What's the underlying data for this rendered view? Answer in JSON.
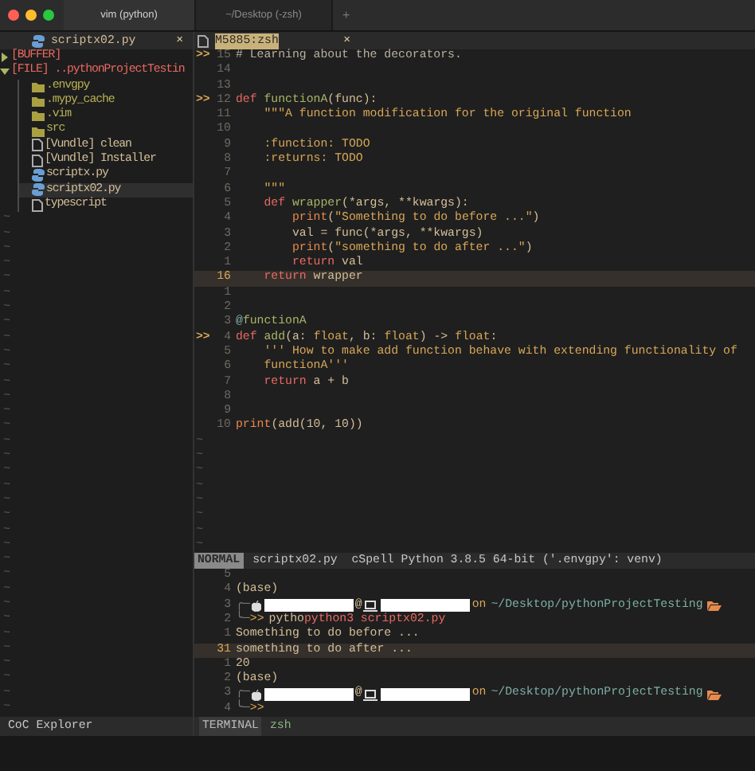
{
  "window": {
    "tabs": [
      {
        "label": "vim (python)",
        "selected": true
      },
      {
        "label": "~/Desktop (-zsh)",
        "selected": false
      }
    ],
    "new_tab": "+"
  },
  "sidebar": {
    "tab": {
      "label": "scriptx02.py",
      "close": "×"
    },
    "tree": [
      {
        "label": "[BUFFER]",
        "kind": "group",
        "expanded": false
      },
      {
        "label": "[FILE] ..pythonProjectTestin",
        "kind": "group",
        "expanded": true,
        "children": [
          {
            "label": ".envgpy",
            "kind": "folder",
            "selected": false
          },
          {
            "label": ".mypy_cache",
            "kind": "folder",
            "selected": false
          },
          {
            "label": ".vim",
            "kind": "folder",
            "selected": false
          },
          {
            "label": "src",
            "kind": "folder",
            "selected": false
          },
          {
            "label": "[Vundle] clean",
            "kind": "file",
            "selected": false
          },
          {
            "label": "[Vundle] Installer",
            "kind": "file",
            "selected": false
          },
          {
            "label": "scriptx.py",
            "kind": "python",
            "selected": false
          },
          {
            "label": "scriptx02.py",
            "kind": "python",
            "selected": true
          },
          {
            "label": "typescript",
            "kind": "file",
            "selected": false
          }
        ]
      }
    ],
    "empty_lines": [
      "~",
      "~",
      "~",
      "~",
      "~",
      "~",
      "~",
      "~",
      "~",
      "~",
      "~",
      "~",
      "~",
      "~",
      "~",
      "~",
      "~",
      "~",
      "~",
      "~",
      "~",
      "~",
      "~",
      "~",
      "~",
      "~",
      "~",
      "~",
      "~",
      "~",
      "~",
      "~",
      "~",
      "~"
    ],
    "title": "CoC Explorer"
  },
  "editor": {
    "tab": {
      "label": "M5885:zsh",
      "close": "×"
    },
    "lines": [
      {
        "num": "15",
        "sign": ">>",
        "current": false,
        "tokens": [
          {
            "text": "# Learning about the decorators.",
            "kind": "comment"
          }
        ]
      },
      {
        "num": "14",
        "current": false
      },
      {
        "num": "13",
        "current": false
      },
      {
        "num": "12",
        "sign": ">>",
        "current": false,
        "tokens": [
          {
            "text": "def ",
            "kind": "keyword"
          },
          {
            "text": "functionA",
            "kind": "function"
          },
          {
            "text": "(",
            "kind": "plain"
          },
          {
            "text": "func",
            "kind": "param"
          },
          {
            "text": "):",
            "kind": "plain"
          }
        ]
      },
      {
        "num": "11",
        "current": false,
        "tokens": [
          {
            "text": "    \"\"\"A function modification for the original function",
            "kind": "string"
          }
        ]
      },
      {
        "num": "10",
        "current": false
      },
      {
        "num": "9",
        "current": false,
        "tokens": [
          {
            "text": "    :function: TODO",
            "kind": "string"
          }
        ]
      },
      {
        "num": "8",
        "current": false,
        "tokens": [
          {
            "text": "    :returns: TODO",
            "kind": "string"
          }
        ]
      },
      {
        "num": "7",
        "current": false
      },
      {
        "num": "6",
        "current": false,
        "tokens": [
          {
            "text": "    \"\"\"",
            "kind": "string"
          }
        ]
      },
      {
        "num": "5",
        "current": false,
        "tokens": [
          {
            "text": "    def ",
            "kind": "keyword"
          },
          {
            "text": "wrapper",
            "kind": "function"
          },
          {
            "text": "(*args, **kwargs):",
            "kind": "plain"
          }
        ]
      },
      {
        "num": "4",
        "current": false,
        "tokens": [
          {
            "text": "        print",
            "kind": "builtin"
          },
          {
            "text": "(",
            "kind": "plain"
          },
          {
            "text": "\"Something to do before ...\"",
            "kind": "string"
          },
          {
            "text": ")",
            "kind": "plain"
          }
        ]
      },
      {
        "num": "3",
        "current": false,
        "tokens": [
          {
            "text": "        val = func(*args, **kwargs)",
            "kind": "plain"
          }
        ]
      },
      {
        "num": "2",
        "current": false,
        "tokens": [
          {
            "text": "        print",
            "kind": "builtin"
          },
          {
            "text": "(",
            "kind": "plain"
          },
          {
            "text": "\"something to do after ...\"",
            "kind": "string"
          },
          {
            "text": ")",
            "kind": "plain"
          }
        ]
      },
      {
        "num": "1",
        "current": false,
        "tokens": [
          {
            "text": "        return",
            "kind": "keyword"
          },
          {
            "text": " val",
            "kind": "plain"
          }
        ]
      },
      {
        "num": "16",
        "current": true,
        "tokens": [
          {
            "text": "    return",
            "kind": "keyword"
          },
          {
            "text": " wrapper",
            "kind": "plain"
          }
        ]
      },
      {
        "num": "1",
        "current": false
      },
      {
        "num": "2",
        "current": false
      },
      {
        "num": "3",
        "current": false,
        "tokens": [
          {
            "text": "@",
            "kind": "decorator"
          },
          {
            "text": "functionA",
            "kind": "function"
          }
        ]
      },
      {
        "num": "4",
        "sign": ">>",
        "current": false,
        "tokens": [
          {
            "text": "def ",
            "kind": "keyword"
          },
          {
            "text": "add",
            "kind": "function"
          },
          {
            "text": "(a: ",
            "kind": "plain"
          },
          {
            "text": "float",
            "kind": "type"
          },
          {
            "text": ", b: ",
            "kind": "plain"
          },
          {
            "text": "float",
            "kind": "type"
          },
          {
            "text": ") -> ",
            "kind": "plain"
          },
          {
            "text": "float",
            "kind": "type"
          },
          {
            "text": ":",
            "kind": "plain"
          }
        ]
      },
      {
        "num": "5",
        "current": false,
        "tokens": [
          {
            "text": "    ''' How to make add function behave with extending functionality of",
            "kind": "string"
          }
        ]
      },
      {
        "num": "6",
        "current": false,
        "tokens": [
          {
            "text": "    functionA'''",
            "kind": "string"
          }
        ]
      },
      {
        "num": "7",
        "current": false,
        "tokens": [
          {
            "text": "    return",
            "kind": "keyword"
          },
          {
            "text": " a + b",
            "kind": "plain"
          }
        ]
      },
      {
        "num": "8",
        "current": false
      },
      {
        "num": "9",
        "current": false
      },
      {
        "num": "10",
        "current": false,
        "tokens": [
          {
            "text": "print",
            "kind": "builtin"
          },
          {
            "text": "(add(10, 10))",
            "kind": "plain"
          }
        ]
      }
    ],
    "empty_lines": [
      "~",
      "~",
      "~",
      "~",
      "~",
      "~",
      "~",
      "~"
    ]
  },
  "statusline": {
    "mode": "NORMAL",
    "text": "scriptx02.py  cSpell Python 3.8.5 64-bit ('.envgpy': venv)"
  },
  "terminal": {
    "lines": [
      {
        "num": "5",
        "current": false
      },
      {
        "num": "4",
        "current": false,
        "parts": [
          {
            "kind": "text",
            "text": "(base)"
          }
        ]
      },
      {
        "num": "3",
        "current": false,
        "parts": [
          {
            "kind": "branch",
            "text": "╭─"
          },
          {
            "kind": "apple-icon"
          },
          {
            "kind": "redacted"
          },
          {
            "kind": "text",
            "text": "@"
          },
          {
            "kind": "laptop-icon"
          },
          {
            "kind": "redacted"
          },
          {
            "kind": "keyword",
            "text": "on"
          },
          {
            "kind": "path",
            "text": "~/Desktop/pythonProjectTesting"
          },
          {
            "kind": "folder-icon"
          }
        ]
      },
      {
        "num": "2",
        "current": false,
        "parts": [
          {
            "kind": "branch",
            "text": "╰─"
          },
          {
            "kind": "keyword",
            "text": ">>"
          },
          {
            "kind": "text",
            "text": "pytho"
          },
          {
            "kind": "command",
            "text": "python3 scriptx02.py"
          }
        ]
      },
      {
        "num": "1",
        "current": false,
        "parts": [
          {
            "kind": "text",
            "text": "Something to do before ..."
          }
        ]
      },
      {
        "num": "31",
        "current": true,
        "parts": [
          {
            "kind": "text",
            "text": "something to do after ..."
          }
        ]
      },
      {
        "num": "1",
        "current": false,
        "parts": [
          {
            "kind": "text",
            "text": "20"
          }
        ]
      },
      {
        "num": "2",
        "current": false,
        "parts": [
          {
            "kind": "text",
            "text": "(base)"
          }
        ]
      },
      {
        "num": "3",
        "current": false,
        "parts": [
          {
            "kind": "branch",
            "text": "╭─"
          },
          {
            "kind": "apple-icon"
          },
          {
            "kind": "redacted"
          },
          {
            "kind": "text",
            "text": "@"
          },
          {
            "kind": "laptop-icon"
          },
          {
            "kind": "redacted"
          },
          {
            "kind": "keyword",
            "text": "on"
          },
          {
            "kind": "path",
            "text": "~/Desktop/pythonProjectTesting"
          },
          {
            "kind": "folder-icon"
          }
        ]
      },
      {
        "num": "4",
        "current": false,
        "parts": [
          {
            "kind": "branch",
            "text": "╰─"
          },
          {
            "kind": "keyword",
            "text": ">>"
          }
        ]
      }
    ],
    "label": "TERMINAL",
    "shell": "zsh"
  }
}
